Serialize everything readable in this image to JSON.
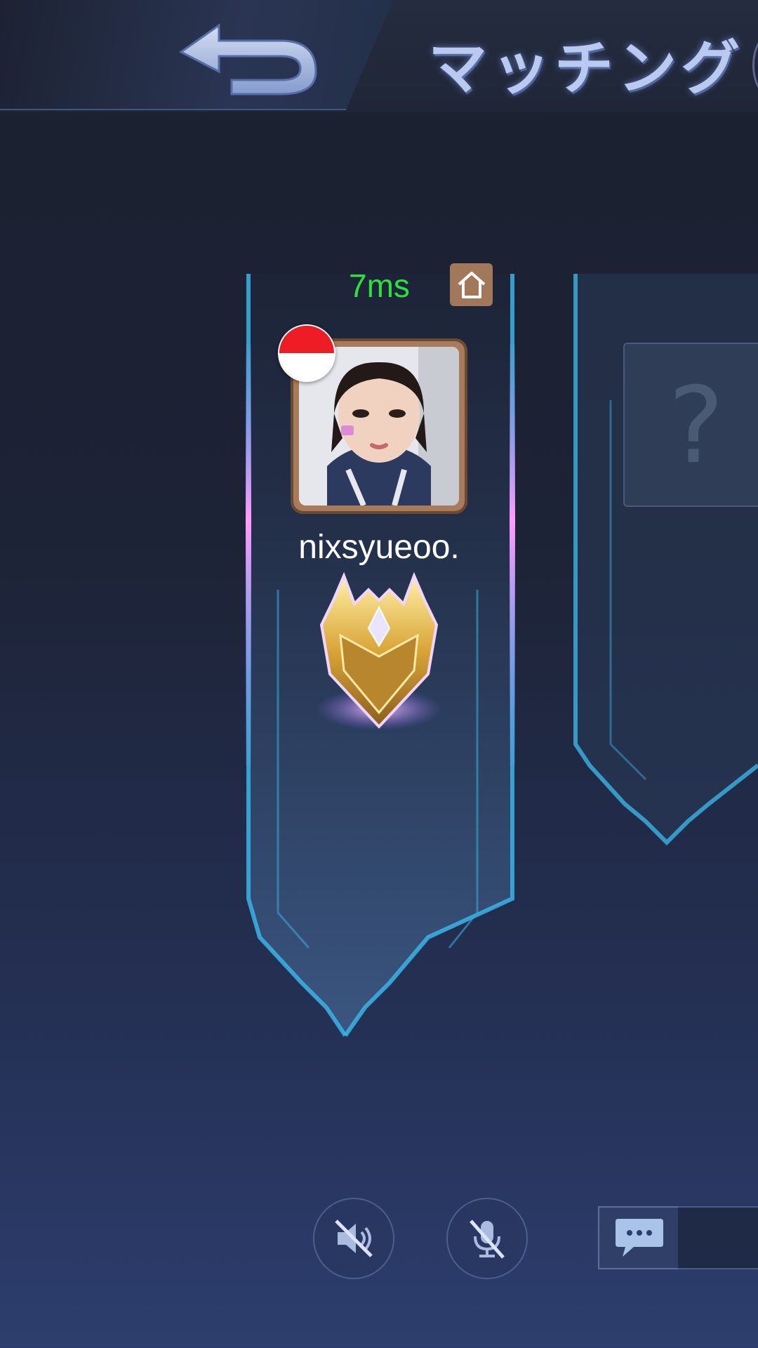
{
  "header": {
    "title": "マッチング",
    "back_icon": "back-arrow-icon"
  },
  "player": {
    "ping": "7ms",
    "ping_color": "#2fe03c",
    "home_icon": "home-icon",
    "flag_icon": "indonesia-flag-icon",
    "avatar": "player-avatar",
    "username": "nixsyueoo.",
    "rank_icon": "rank-emblem-icon"
  },
  "empty_slot": {
    "placeholder": "?"
  },
  "controls": {
    "speaker_icon": "speaker-muted-icon",
    "mic_icon": "mic-muted-icon",
    "chat_icon": "chat-bubble-icon"
  },
  "colors": {
    "accent": "#3bb4e6",
    "glow": "#e38cff",
    "badge_brown": "#a2785a"
  }
}
